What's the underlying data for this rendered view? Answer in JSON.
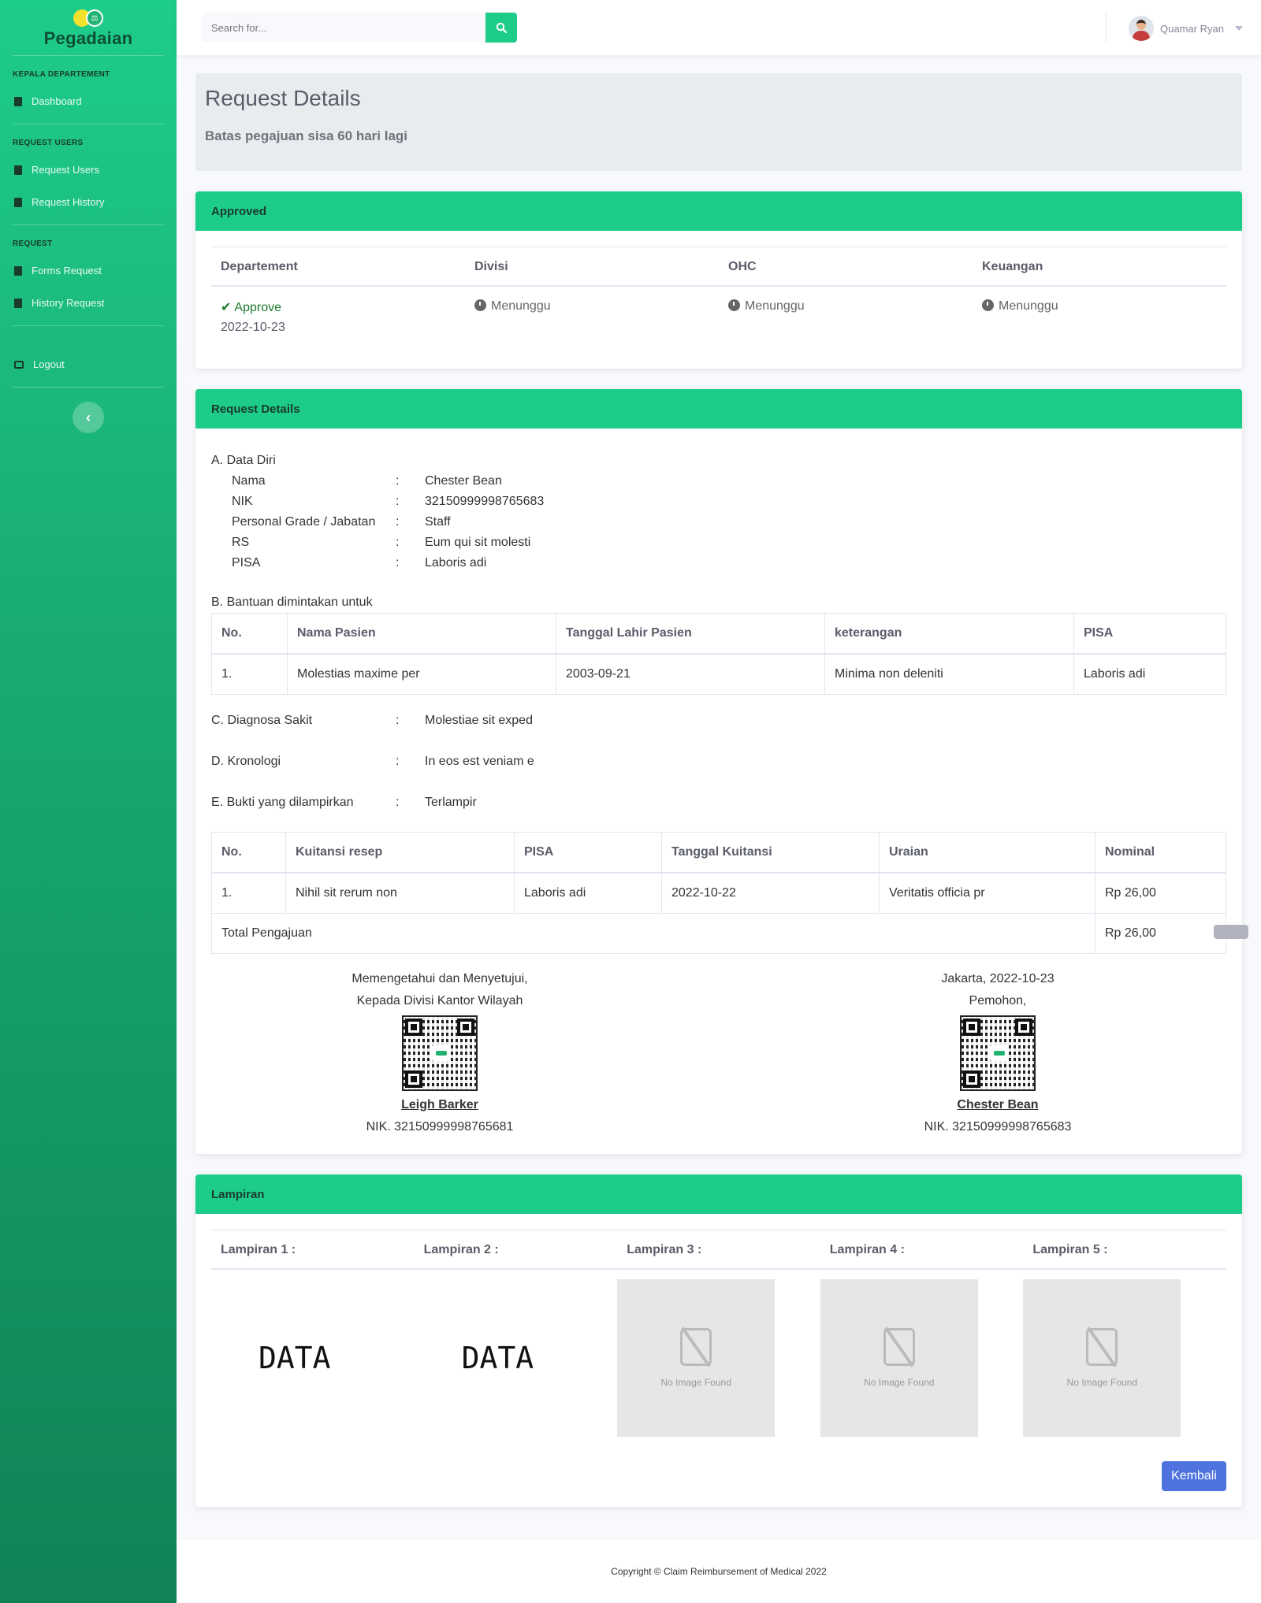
{
  "brand": {
    "name": "Pegadaian"
  },
  "sidebar": {
    "sections": [
      {
        "heading": "KEPALA DEPARTEMENT",
        "items": [
          {
            "label": "Dashboard",
            "icon": "clipboard-icon"
          }
        ]
      },
      {
        "heading": "REQUEST USERS",
        "items": [
          {
            "label": "Request Users",
            "icon": "clipboard-icon"
          },
          {
            "label": "Request History",
            "icon": "book-icon"
          }
        ]
      },
      {
        "heading": "REQUEST",
        "items": [
          {
            "label": "Forms Request",
            "icon": "clipboard-icon"
          },
          {
            "label": "History Request",
            "icon": "book-icon"
          }
        ]
      }
    ],
    "logout": "Logout",
    "toggle": "‹"
  },
  "topbar": {
    "search_placeholder": "Search for...",
    "user_name": "Quamar Ryan"
  },
  "page": {
    "title": "Request Details",
    "deadline": "Batas pegajuan sisa 60 hari lagi"
  },
  "approval": {
    "header": "Approved",
    "columns": [
      "Departement",
      "Divisi",
      "OHC",
      "Keuangan"
    ],
    "departement": {
      "status": "Approve",
      "date": "2022-10-23"
    },
    "divisi": "Menunggu",
    "ohc": "Menunggu",
    "keuangan": "Menunggu"
  },
  "details": {
    "header": "Request Details",
    "section_a": "A. Data Diri",
    "data_diri": [
      {
        "label": "Nama",
        "value": "Chester Bean"
      },
      {
        "label": "NIK",
        "value": "32150999998765683"
      },
      {
        "label": "Personal Grade / Jabatan",
        "value": "Staff"
      },
      {
        "label": "RS",
        "value": "Eum qui sit molesti"
      },
      {
        "label": "PISA",
        "value": "Laboris adi"
      }
    ],
    "colon": ":",
    "section_b": "B. Bantuan dimintakan untuk",
    "bantuan_columns": [
      "No.",
      "Nama Pasien",
      "Tanggal Lahir Pasien",
      "keterangan",
      "PISA"
    ],
    "bantuan_rows": [
      [
        "1.",
        "Molestias maxime per",
        "2003-09-21",
        "Minima non deleniti",
        "Laboris adi"
      ]
    ],
    "diagnosa_label": "C. Diagnosa Sakit",
    "diagnosa_value": "Molestiae sit exped",
    "kronologi_label": "D. Kronologi",
    "kronologi_value": "In eos est veniam e",
    "bukti_label": "E. Bukti yang dilampirkan",
    "bukti_value": "Terlampir",
    "kuitansi_columns": [
      "No.",
      "Kuitansi resep",
      "PISA",
      "Tanggal Kuitansi",
      "Uraian",
      "Nominal"
    ],
    "kuitansi_rows": [
      [
        "1.",
        "Nihil sit rerum non",
        "Laboris adi",
        "2022-10-22",
        "Veritatis officia pr",
        "Rp 26,00"
      ]
    ],
    "total_label": "Total Pengajuan",
    "total_value": "Rp 26,00",
    "sign_left": {
      "line1": "Memengetahui dan Menyetujui,",
      "line2": "Kepada Divisi Kantor Wilayah",
      "name": "Leigh Barker",
      "nik": "NIK. 32150999998765681"
    },
    "sign_right": {
      "line1": "Jakarta, 2022-10-23",
      "line2": "Pemohon,",
      "name": "Chester Bean",
      "nik": "NIK. 32150999998765683"
    }
  },
  "lampiran": {
    "header": "Lampiran",
    "columns": [
      "Lampiran 1 :",
      "Lampiran 2 :",
      "Lampiran 3 :",
      "Lampiran 4 :",
      "Lampiran 5 :"
    ],
    "data_text": "DATA",
    "no_image": "No Image Found",
    "back_button": "Kembali"
  },
  "footer": {
    "text": "Copyright © Claim Reimbursement of Medical 2022"
  },
  "colors": {
    "primary": "#1ecc8a",
    "button_blue": "#4e73df",
    "approve_green": "#1a7a2c"
  }
}
